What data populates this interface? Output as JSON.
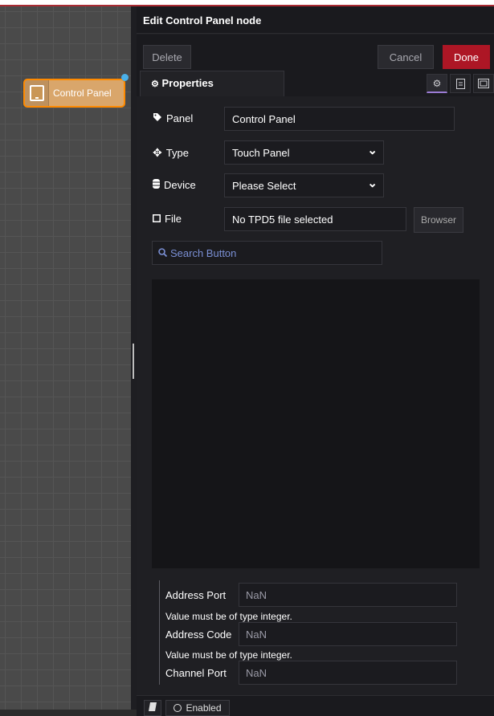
{
  "workspace": {
    "node": {
      "label": "Control Panel"
    }
  },
  "tray": {
    "title": "Edit Control Panel node",
    "buttons": {
      "delete": "Delete",
      "cancel": "Cancel",
      "done": "Done"
    },
    "tab": {
      "label": "Properties"
    }
  },
  "form": {
    "panel": {
      "label": "Panel",
      "value": "Control Panel"
    },
    "type": {
      "label": "Type",
      "value": "Touch Panel"
    },
    "device": {
      "label": "Device",
      "value": "Please Select"
    },
    "file": {
      "label": "File",
      "value": "No TPD5 file selected",
      "browser": "Browser"
    },
    "search": {
      "placeholder": "Search Button"
    }
  },
  "lower": {
    "address_port": {
      "label": "Address Port",
      "value": "NaN"
    },
    "address_code": {
      "label": "Address Code",
      "value": "NaN"
    },
    "channel_port": {
      "label": "Channel Port",
      "value": "NaN"
    },
    "error": "Value must be of type integer."
  },
  "statusbar": {
    "enabled": "Enabled"
  },
  "colors": {
    "done": "#ad1625",
    "node": "#d9a66b",
    "accent": "#9b7bd4"
  }
}
